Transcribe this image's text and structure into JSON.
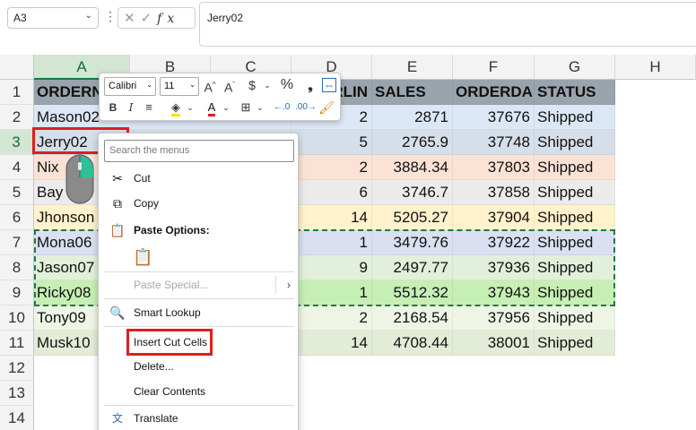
{
  "formula_bar": {
    "name_box": "A3",
    "fx": "fx",
    "value": "Jerry02"
  },
  "columns": [
    "A",
    "B",
    "C",
    "D",
    "E",
    "F",
    "G",
    "H"
  ],
  "rows": [
    "1",
    "2",
    "3",
    "4",
    "5",
    "6",
    "7",
    "8",
    "9",
    "10",
    "11",
    "12",
    "13",
    "14"
  ],
  "headers": {
    "a": "ORDERN",
    "d": "ARLIN",
    "e": "SALES",
    "f": "ORDERDA",
    "g": "STATUS"
  },
  "data": [
    {
      "a": "Mason02",
      "bc_partial": "…",
      "d": "2",
      "e": "2871",
      "f": "37676",
      "g": "Shipped",
      "color": "#dbe7f4"
    },
    {
      "a": "Jerry02",
      "d": "5",
      "e": "2765.9",
      "f": "37748",
      "g": "Shipped",
      "color": "#d6dee9"
    },
    {
      "a": "Nix",
      "d": "2",
      "e": "3884.34",
      "f": "37803",
      "g": "Shipped",
      "color": "#fbe2d5"
    },
    {
      "a": "Bay",
      "d": "6",
      "e": "3746.7",
      "f": "37858",
      "g": "Shipped",
      "color": "#ebebeb"
    },
    {
      "a": "Jhonson",
      "d": "14",
      "e": "5205.27",
      "f": "37904",
      "g": "Shipped",
      "color": "#fff2cc"
    },
    {
      "a": "Mona06",
      "d": "1",
      "e": "3479.76",
      "f": "37922",
      "g": "Shipped",
      "color": "#dae0f1"
    },
    {
      "a": "Jason07",
      "d": "9",
      "e": "2497.77",
      "f": "37936",
      "g": "Shipped",
      "color": "#e2efda"
    },
    {
      "a": "Ricky08",
      "d": "1",
      "e": "5512.32",
      "f": "37943",
      "g": "Shipped",
      "color": "#c6efb4"
    },
    {
      "a": "Tony09",
      "d": "2",
      "e": "2168.54",
      "f": "37956",
      "g": "Shipped",
      "color": "#eef5e4"
    },
    {
      "a": "Musk10",
      "d": "14",
      "e": "4708.44",
      "f": "38001",
      "g": "Shipped",
      "color": "#e2ecd6"
    }
  ],
  "mini_toolbar": {
    "font": "Calibri",
    "size": "11",
    "bold": "B",
    "italic": "I",
    "percent": "%",
    "currency": "$"
  },
  "context_menu": {
    "search_placeholder": "Search the menus",
    "cut": "Cut",
    "copy": "Copy",
    "paste_options": "Paste Options:",
    "paste_special": "Paste Special...",
    "smart_lookup": "Smart Lookup",
    "insert_cut_cells": "Insert Cut Cells",
    "delete": "Delete...",
    "clear_contents": "Clear Contents",
    "translate": "Translate"
  },
  "colors": {
    "header_fill": "#9aa4ad",
    "highlight_red": "#e01e1e",
    "excel_green": "#107c41"
  }
}
